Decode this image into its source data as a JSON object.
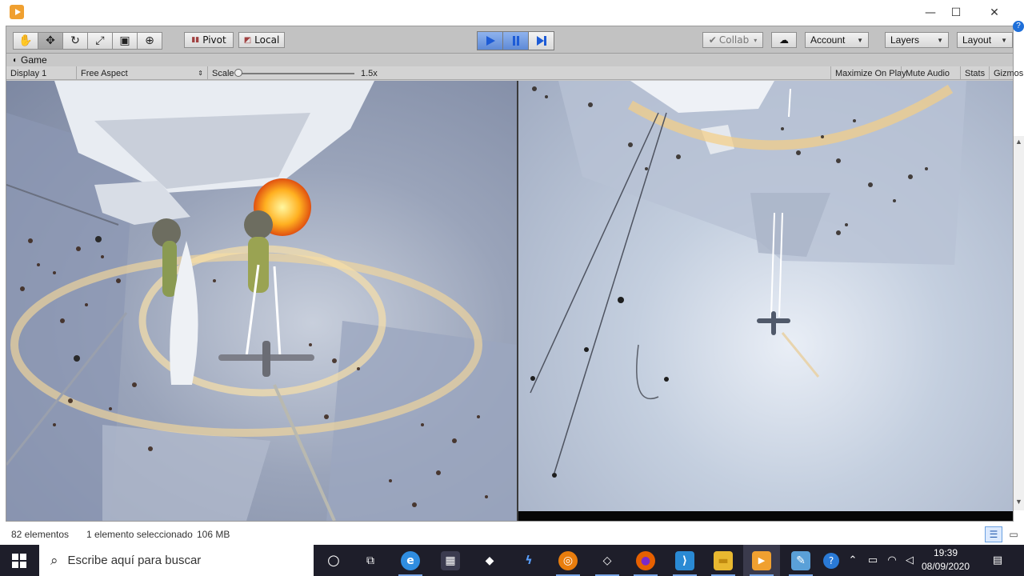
{
  "window": {
    "minimize_glyph": "—",
    "maximize_glyph": "☐",
    "close_glyph": "✕"
  },
  "toolbar": {
    "tools": [
      {
        "name": "hand-tool",
        "glyph": "✋"
      },
      {
        "name": "move-tool",
        "glyph": "✥"
      },
      {
        "name": "rotate-tool",
        "glyph": "↻"
      },
      {
        "name": "scale-tool",
        "glyph": "⤢"
      },
      {
        "name": "rect-tool",
        "glyph": "▣"
      },
      {
        "name": "transform-tool",
        "glyph": "⊕"
      }
    ],
    "pivot_label": "Pivot",
    "local_label": "Local",
    "collab_label": "Collab",
    "account_label": "Account",
    "layers_label": "Layers",
    "layout_label": "Layout"
  },
  "game": {
    "tab_label": "Game",
    "display_label": "Display 1",
    "aspect_label": "Free Aspect",
    "scale_label": "Scale",
    "scale_value": "1.5x",
    "maximize_label": "Maximize On Play",
    "mute_label": "Mute Audio",
    "stats_label": "Stats",
    "gizmos_label": "Gizmos"
  },
  "status": {
    "elements": "82 elementos",
    "selected": "1 elemento seleccionado",
    "size": "106 MB"
  },
  "taskbar": {
    "search_placeholder": "Escribe aquí para buscar",
    "apps": [
      {
        "name": "cortana",
        "glyph": "○",
        "color": "#1e1e2a"
      },
      {
        "name": "task-view",
        "glyph": "⧉",
        "color": "#1e1e2a"
      },
      {
        "name": "edge",
        "glyph": "e",
        "color": "#2f8de0"
      },
      {
        "name": "store",
        "glyph": "▦",
        "color": "#2d2d3a"
      },
      {
        "name": "dropbox",
        "glyph": "◆",
        "color": "#1e1e2a"
      },
      {
        "name": "visual-studio-app",
        "glyph": "ϟ",
        "color": "#1e1e2a"
      },
      {
        "name": "blender",
        "glyph": "◎",
        "color": "#e87d0d"
      },
      {
        "name": "unity-hub",
        "glyph": "◇",
        "color": "#1e1e2a"
      },
      {
        "name": "firefox",
        "glyph": "●",
        "color": "#e66000"
      },
      {
        "name": "vscode",
        "glyph": "⟩",
        "color": "#2a8ad4"
      },
      {
        "name": "file-explorer",
        "glyph": "▬",
        "color": "#e8b830"
      },
      {
        "name": "player",
        "glyph": "▶",
        "color": "#f0a030"
      },
      {
        "name": "paint",
        "glyph": "✎",
        "color": "#5aa0d8"
      }
    ],
    "time": "19:39",
    "date": "08/09/2020"
  },
  "colors": {
    "play_active": "#4a7bd0",
    "taskbar_bg": "#1e1e2a"
  }
}
